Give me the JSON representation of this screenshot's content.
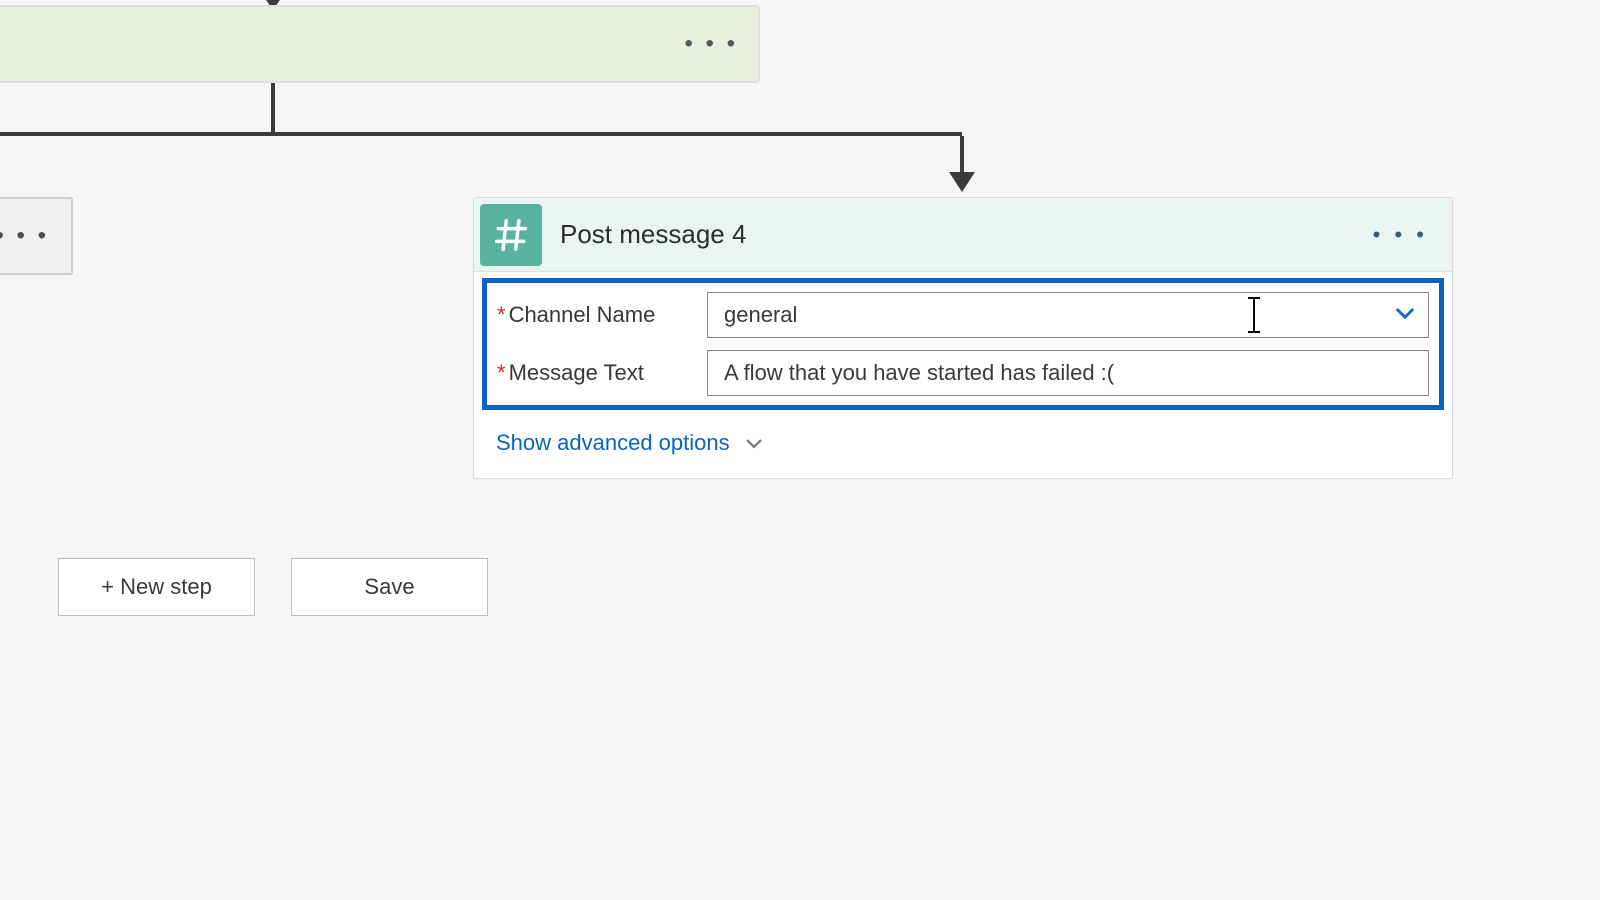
{
  "action": {
    "title": "Post message 4",
    "params": {
      "channel_label": "Channel Name",
      "channel_value": "general",
      "message_label": "Message Text",
      "message_value": "A flow that you have started has failed :("
    },
    "advanced_label": "Show advanced options"
  },
  "buttons": {
    "new_step": "+ New step",
    "save": "Save"
  },
  "ellipsis": "• • •"
}
